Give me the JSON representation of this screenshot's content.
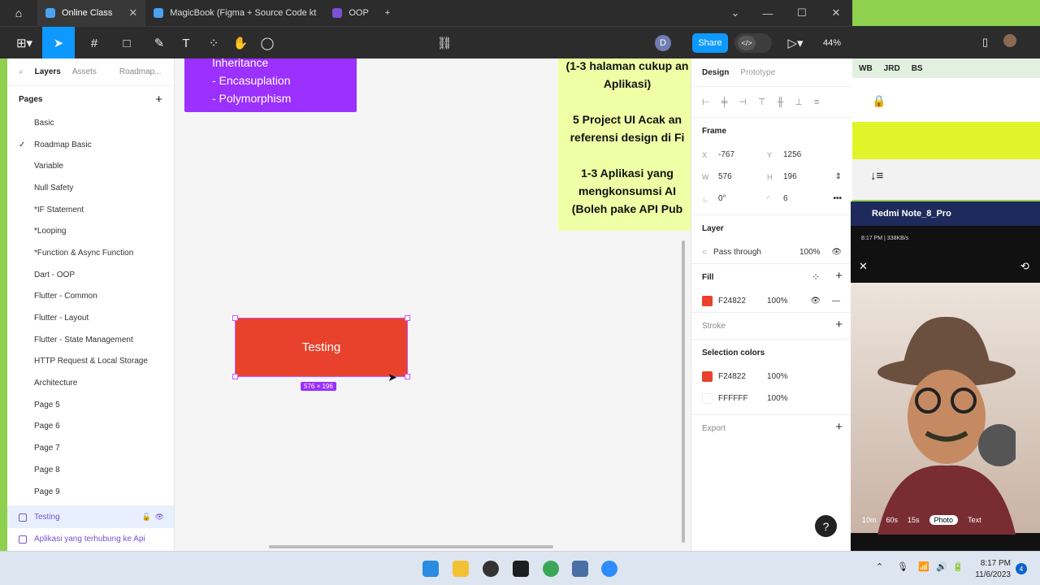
{
  "browser": {
    "tabs": [
      {
        "label": "Online Class",
        "active": true
      },
      {
        "label": "MagicBook (Figma + Source Code kt",
        "active": false
      },
      {
        "label": "OOP",
        "active": false
      }
    ],
    "new_tab": "+"
  },
  "toolbar": {
    "share_label": "Share",
    "zoom": "44%",
    "avatar_initial": "D"
  },
  "left_panel": {
    "tabs": [
      "Layers",
      "Assets",
      "Roadmap..."
    ],
    "pages_title": "Pages",
    "pages": [
      "Basic",
      "Roadmap Basic",
      "Variable",
      "Null Safety",
      "*IF Statement",
      "*Looping",
      "*Function & Async Function",
      "Dart - OOP",
      "Flutter - Common",
      "Flutter - Layout",
      "Flutter - State Management",
      "HTTP Request & Local Storage",
      "Architecture",
      "Page 5",
      "Page 6",
      "Page 7",
      "Page 8",
      "Page 9"
    ],
    "current_page": "Roadmap Basic",
    "layers": [
      "Testing",
      "Aplikasi yang terhubung ke Api"
    ]
  },
  "canvas": {
    "purple_lines": [
      "Inheritance",
      "- Encasuplation",
      "- Polymorphism"
    ],
    "yellow_text": "(1-3 halaman cukup an\nAplikasi)\n\n5 Project UI Acak an\nreferensi design di Fi\n\n1-3 Aplikasi yang\nmengkonsumsi AI\n(Boleh pake API Pub",
    "frame_label": "Testing",
    "size_badge": "576 × 196"
  },
  "right_panel": {
    "tabs": [
      "Design",
      "Prototype"
    ],
    "frame_title": "Frame",
    "x_label": "X",
    "x": "-767",
    "y_label": "Y",
    "y": "1256",
    "w_label": "W",
    "w": "576",
    "h_label": "H",
    "h": "196",
    "rotation": "0°",
    "radius": "6",
    "layer_title": "Layer",
    "blend": "Pass through",
    "opacity": "100%",
    "fill_title": "Fill",
    "fill_color": "F24822",
    "fill_opacity": "100%",
    "stroke_title": "Stroke",
    "selection_colors_title": "Selection colors",
    "sel_colors": [
      {
        "hex": "F24822",
        "pct": "100%"
      },
      {
        "hex": "FFFFFF",
        "pct": "100%"
      }
    ],
    "export_title": "Export",
    "help": "?"
  },
  "side": {
    "bookmarks": [
      "WB",
      "JRD",
      "BS"
    ],
    "phone_title": "Redmi Note_8_Pro",
    "phone_status": "8:17 PM | 338KB/s",
    "camera_modes": [
      "10m",
      "60s",
      "15s",
      "Photo",
      "Text"
    ]
  },
  "taskbar": {
    "time": "8:17 PM",
    "date": "11/6/2023",
    "notif": "4"
  },
  "colors": {
    "fill": "#e8422d",
    "purple": "#9b30ff",
    "yellow": "#efffa5",
    "accent": "#0d99ff"
  }
}
